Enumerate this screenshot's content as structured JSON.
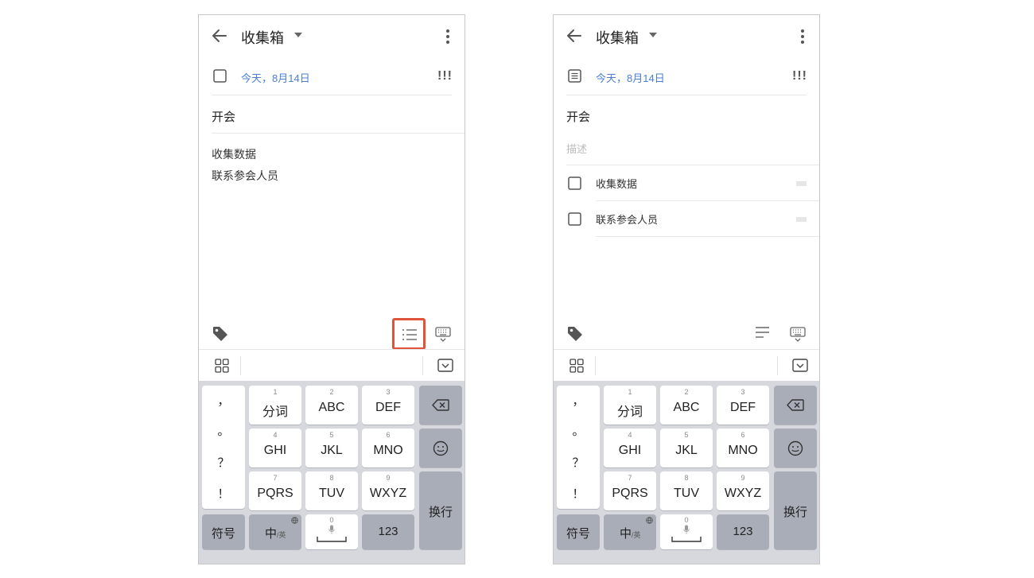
{
  "screens": [
    {
      "header": {
        "title": "收集箱"
      },
      "date": {
        "text": "今天，8月14日",
        "priority": "!!!"
      },
      "task": {
        "title": "开会"
      },
      "description": {
        "lines": [
          "收集数据",
          "联系参会人员"
        ]
      },
      "toolbar": {
        "checklist_highlighted": true
      }
    },
    {
      "header": {
        "title": "收集箱"
      },
      "date": {
        "text": "今天，8月14日",
        "priority": "!!!"
      },
      "task": {
        "title": "开会"
      },
      "description": {
        "placeholder": "描述"
      },
      "checklist": {
        "items": [
          "收集数据",
          "联系参会人员"
        ]
      },
      "toolbar": {
        "checklist_highlighted": false
      }
    }
  ],
  "keyboard": {
    "punctuation": [
      "，",
      "。",
      "？",
      "！"
    ],
    "row1": [
      {
        "num": "1",
        "label": "分词"
      },
      {
        "num": "2",
        "label": "ABC"
      },
      {
        "num": "3",
        "label": "DEF"
      }
    ],
    "row2": [
      {
        "num": "4",
        "label": "GHI"
      },
      {
        "num": "5",
        "label": "JKL"
      },
      {
        "num": "6",
        "label": "MNO"
      }
    ],
    "row3": [
      {
        "num": "7",
        "label": "PQRS"
      },
      {
        "num": "8",
        "label": "TUV"
      },
      {
        "num": "9",
        "label": "WXYZ"
      }
    ],
    "symbols_label": "符号",
    "lang_label": "中",
    "lang_sub": "/英",
    "space_num": "0",
    "numbers_label": "123",
    "enter_label": "换行"
  },
  "colors": {
    "accent_date": "#4a7fd4",
    "highlight_box": "#e0533b",
    "keyboard_bg": "#d6d8dd"
  },
  "icons": [
    "back-arrow-icon",
    "caret-down-icon",
    "more-vertical-icon",
    "checkbox-icon",
    "note-icon",
    "tag-icon",
    "checklist-icon",
    "keyboard-icon",
    "grid-icon",
    "collapse-keyboard-icon",
    "backspace-icon",
    "emoji-icon",
    "globe-icon",
    "mic-icon",
    "drag-handle-icon"
  ]
}
